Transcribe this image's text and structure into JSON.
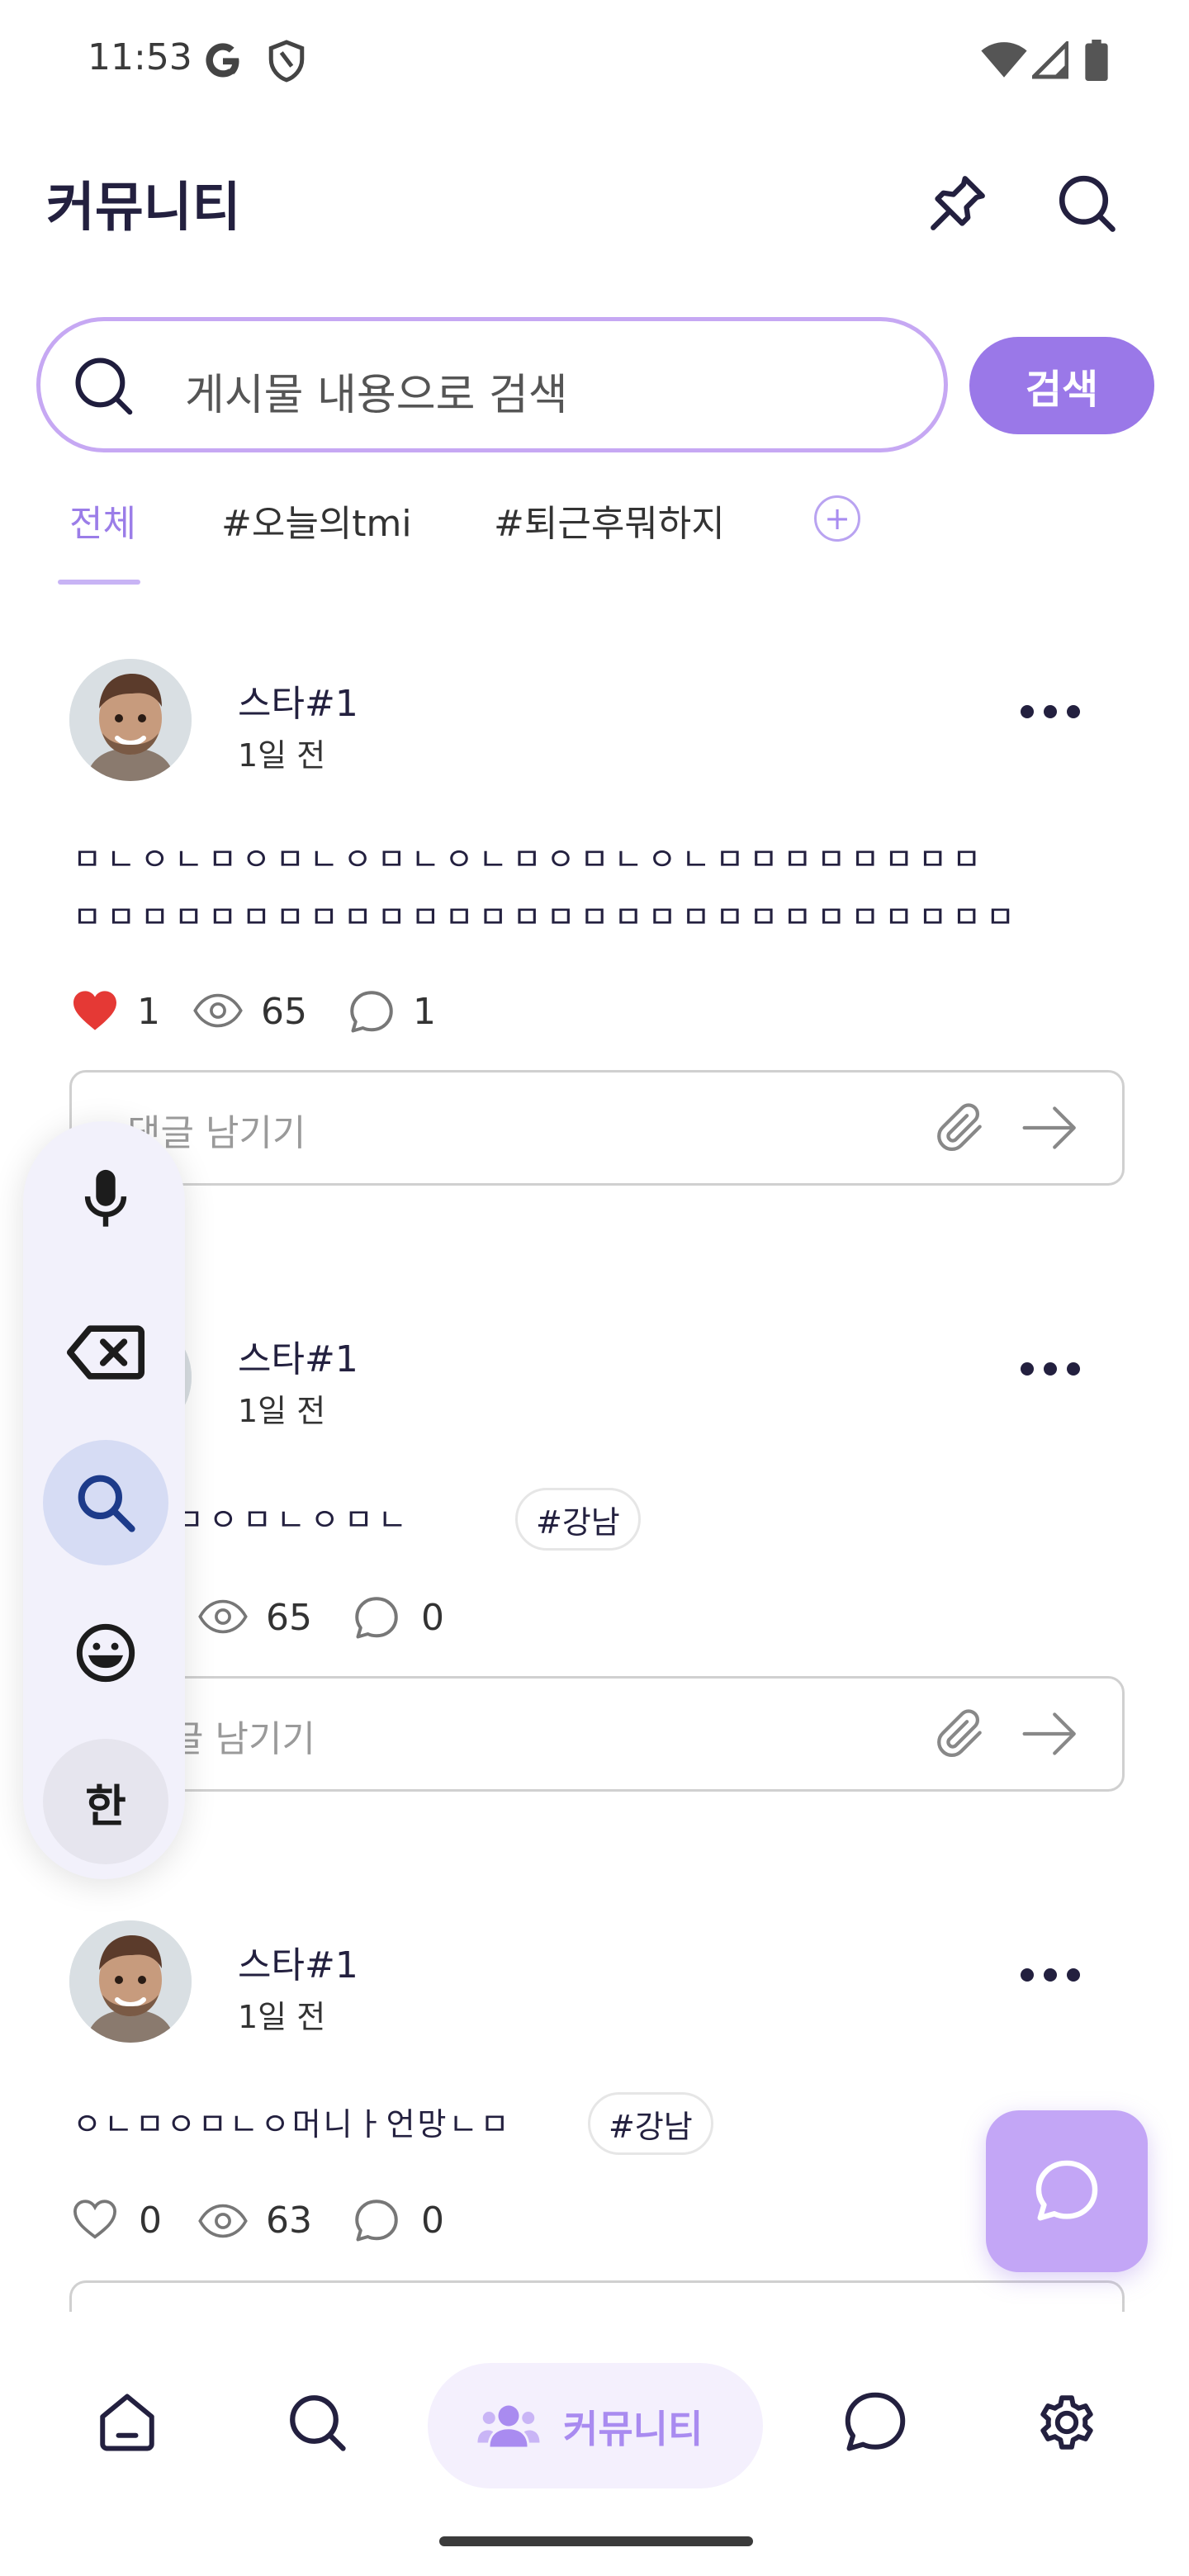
{
  "status_bar": {
    "time": "11:53"
  },
  "header": {
    "title": "커뮤니티"
  },
  "search": {
    "placeholder": "게시물 내용으로 검색",
    "button_label": "검색"
  },
  "tabs": [
    {
      "label": "전체",
      "active": true
    },
    {
      "label": "#오늘의tmi",
      "active": false
    },
    {
      "label": "#퇴근후뭐하지",
      "active": false
    }
  ],
  "posts": [
    {
      "author": "스타#1",
      "time": "1일 전",
      "text_line1": "ㅁㄴㅇㄴㅁㅇㅁㄴㅇㅁㄴㅇㄴㅁㅇㅁㄴㅇㄴㅁㅁㅁㅁㅁㅁㅁㅁ",
      "text_line2": "ㅁㅁㅁㅁㅁㅁㅁㅁㅁㅁㅁㅁㅁㅁㅁㅁㅁㅁㅁㅁㅁㅁㅁㅁㅁㅁㅁㅁ",
      "likes": "1",
      "views": "65",
      "comments": "1",
      "comment_placeholder": "댓글 남기기"
    },
    {
      "author": "스타#1",
      "time": "1일 전",
      "text": "ㅁㅇㅁㅇㅁㄴㅇㅁㄴ",
      "tag": "#강남",
      "views": "65",
      "comments": "0",
      "comment_placeholder": "글 남기기"
    },
    {
      "author": "스타#1",
      "time": "1일 전",
      "text": "ㅇㄴㅁㅇㅁㄴㅇ머니ㅏ언망ㄴㅁ",
      "tag": "#강남",
      "likes": "0",
      "views": "63",
      "comments": "0"
    }
  ],
  "keyboard_toolbar": {
    "language_key": "한"
  },
  "bottom_nav": {
    "active_label": "커뮤니티"
  },
  "colors": {
    "accent": "#9a78e8",
    "accent_light": "#c3a6f6",
    "like_red": "#e53935"
  }
}
